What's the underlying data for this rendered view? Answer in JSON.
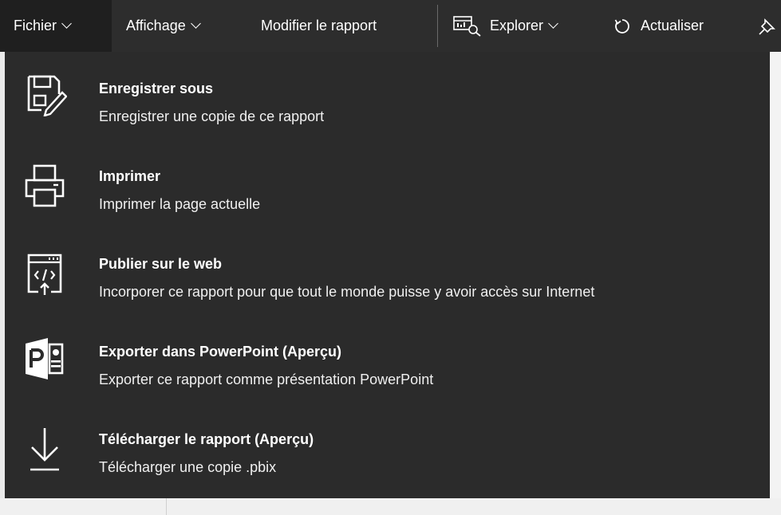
{
  "topbar": {
    "file_label": "Fichier",
    "view_label": "Affichage",
    "edit_label": "Modifier le rapport",
    "explore_label": "Explorer",
    "refresh_label": "Actualiser"
  },
  "icons": {
    "chevron": "chevron-down-icon",
    "explore": "explore-icon",
    "refresh": "refresh-icon",
    "pin": "pin-icon"
  },
  "menu": {
    "items": [
      {
        "icon": "save-as-icon",
        "title": "Enregistrer sous",
        "description": "Enregistrer une copie de ce rapport"
      },
      {
        "icon": "printer-icon",
        "title": "Imprimer",
        "description": "Imprimer la page actuelle"
      },
      {
        "icon": "publish-web-icon",
        "title": "Publier sur le web",
        "description": "Incorporer ce rapport pour que tout le monde puisse y avoir accès sur Internet"
      },
      {
        "icon": "powerpoint-icon",
        "title": "Exporter dans PowerPoint (Aperçu)",
        "description": "Exporter ce rapport comme présentation PowerPoint"
      },
      {
        "icon": "download-icon",
        "title": "Télécharger le rapport (Aperçu)",
        "description": "Télécharger une copie .pbix"
      }
    ]
  },
  "colors": {
    "topbar_bg": "#2d2d2d",
    "active_tab_bg": "#1f1f1f",
    "dropdown_bg": "#2b2b2b",
    "text": "#ffffff",
    "page_bg": "#eaeaea"
  }
}
